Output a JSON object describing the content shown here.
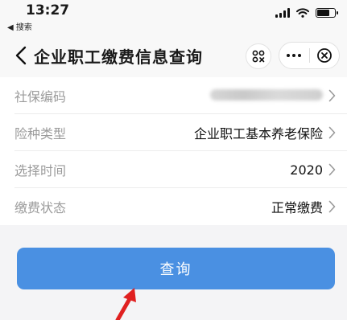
{
  "status_bar": {
    "time": "13:27",
    "back_label": "◀ 搜索"
  },
  "nav": {
    "title": "企业职工缴费信息查询"
  },
  "form": {
    "rows": [
      {
        "label": "社保编码",
        "value": ""
      },
      {
        "label": "险种类型",
        "value": "企业职工基本养老保险"
      },
      {
        "label": "选择时间",
        "value": "2020"
      },
      {
        "label": "缴费状态",
        "value": "正常缴费"
      }
    ]
  },
  "query_button": {
    "label": "查询"
  },
  "colors": {
    "primary": "#4a90e2",
    "annotation_arrow": "#e02020"
  }
}
